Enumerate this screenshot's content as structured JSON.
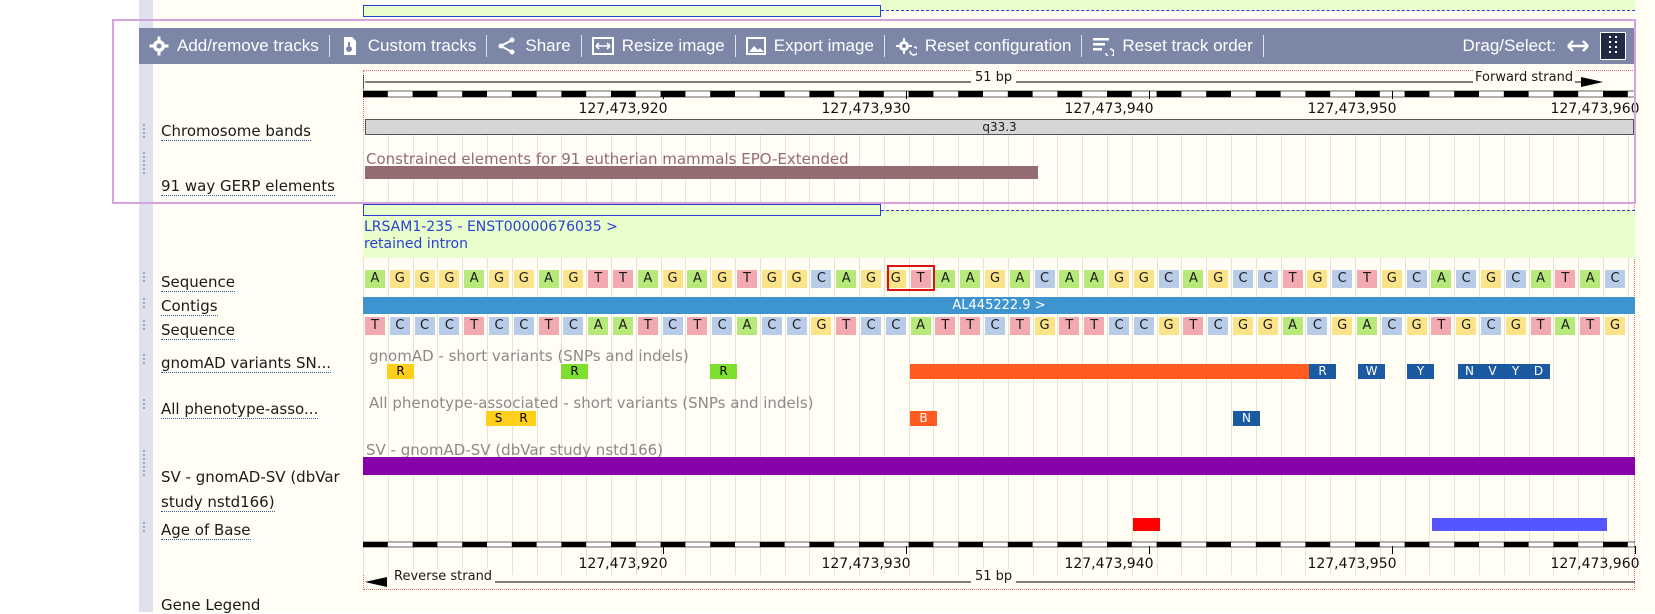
{
  "toolbar": {
    "buttons": [
      {
        "label": "Add/remove tracks",
        "icon": "gear-icon"
      },
      {
        "label": "Custom tracks",
        "icon": "custom-tracks-icon"
      },
      {
        "label": "Share",
        "icon": "share-icon"
      },
      {
        "label": "Resize image",
        "icon": "resize-icon"
      },
      {
        "label": "Export image",
        "icon": "image-icon"
      },
      {
        "label": "Reset configuration",
        "icon": "reset-config-icon"
      },
      {
        "label": "Reset track order",
        "icon": "reset-order-icon"
      }
    ],
    "drag_select_label": "Drag/Select:"
  },
  "ruler": {
    "top_length": "51 bp",
    "forward_strand": "Forward strand",
    "reverse_strand": "Reverse strand",
    "bottom_length": "51 bp",
    "ticks": [
      "127,473,920",
      "127,473,930",
      "127,473,940",
      "127,473,950",
      "127,473,960"
    ]
  },
  "tracks": {
    "chromosome_bands": "Chromosome bands",
    "gerp": "91 way GERP elements",
    "sequence1": "Sequence",
    "contigs": "Contigs",
    "sequence2": "Sequence",
    "gnomad": "gnomAD variants SN...",
    "phenotype": "All phenotype-asso...",
    "sv_line1": "SV - gnomAD-SV (dbVar",
    "sv_line2": "study nstd166)",
    "age": "Age of Base",
    "gene_legend": "Gene Legend"
  },
  "features": {
    "band_label": "q33.3",
    "gerp_desc": "Constrained elements for 91 eutherian mammals EPO-Extended",
    "transcript_name": "LRSAM1-235 - ENST00000676035 >",
    "transcript_biotype": "retained intron",
    "contig_label": "AL445222.9 >",
    "gnomad_desc": "gnomAD - short variants (SNPs and indels)",
    "phenotype_desc": "All phenotype-associated - short variants (SNPs and indels)",
    "sv_desc": "SV - gnomAD-SV (dbVar study nstd166)"
  },
  "sequence_forward": "AGGGAGGAGTTAGAGTGGCAGGTAAGACAAGGCAGCCTGCTGCACGCATAC",
  "sequence_reverse": "TCCCTCCTCAATCTCACCGTCCATTCTGTTCCGTCGGACGACGTGCGTATG",
  "gnomad_marks": [
    "R",
    "R",
    "R",
    "R",
    "W",
    "Y",
    "N",
    "V",
    "Y",
    "D"
  ],
  "phenotype_marks": [
    "S",
    "R",
    "B",
    "N"
  ],
  "colors": {
    "toolbar": "#7c87a7",
    "gerp_bar": "#946b70",
    "transcript_bg": "#e8ffcc",
    "contig_bar": "#3d94cf",
    "gnomad_missense": "#ff5a1f",
    "variant_blue": "#1b5aa0",
    "variant_green": "#7dde2e",
    "variant_yellow": "#ffcf1a",
    "sv_bar": "#8800aa",
    "age_red": "#ff0000",
    "age_blue": "#5656ff"
  }
}
